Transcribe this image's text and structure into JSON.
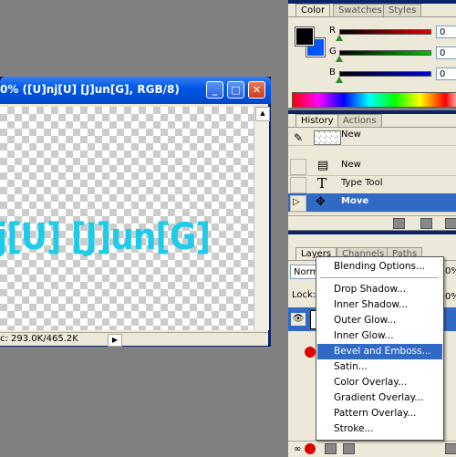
{
  "document": {
    "title": "0% ([U]nj[U] [J]un[G], RGB/8)",
    "canvas_text": "j[U] [J]un[G]",
    "status": "c: 293.0K/465.2K",
    "canvas_text_color": "#1ecbe8",
    "window_buttons": [
      "minimize-icon",
      "maximize-icon",
      "close-icon"
    ]
  },
  "color_palette": {
    "tabs": [
      "Color",
      "Swatches",
      "Styles"
    ],
    "sliders": [
      {
        "label": "R",
        "value": "0",
        "color": "#e00000"
      },
      {
        "label": "G",
        "value": "0",
        "color": "#00c000"
      },
      {
        "label": "B",
        "value": "0",
        "color": "#0000e0"
      }
    ],
    "foreground_color": "#000000",
    "background_color": "#0055ff"
  },
  "history_palette": {
    "tabs": [
      "History",
      "Actions"
    ],
    "items": [
      {
        "label": "New",
        "icon": "snapshot-thumbnail-icon"
      },
      {
        "label": "New",
        "icon": "document-icon"
      },
      {
        "label": "Type Tool",
        "icon": "type-tool-icon"
      },
      {
        "label": "Move",
        "icon": "move-tool-icon"
      }
    ],
    "selected_index": 3
  },
  "layers_palette": {
    "tabs": [
      "Layers",
      "Channels",
      "Paths"
    ],
    "blend_mode": "Norm",
    "lock_label": "Lock:",
    "opacity_fragment": "0%"
  },
  "context_menu": {
    "items": [
      {
        "label": "Blending Options..."
      },
      {
        "label": "Drop Shadow..."
      },
      {
        "label": "Inner Shadow..."
      },
      {
        "label": "Outer Glow..."
      },
      {
        "label": "Inner Glow..."
      },
      {
        "label": "Bevel and Emboss..."
      },
      {
        "label": "Satin..."
      },
      {
        "label": "Color Overlay..."
      },
      {
        "label": "Gradient Overlay..."
      },
      {
        "label": "Pattern Overlay..."
      },
      {
        "label": "Stroke..."
      }
    ],
    "highlighted_index": 5
  }
}
